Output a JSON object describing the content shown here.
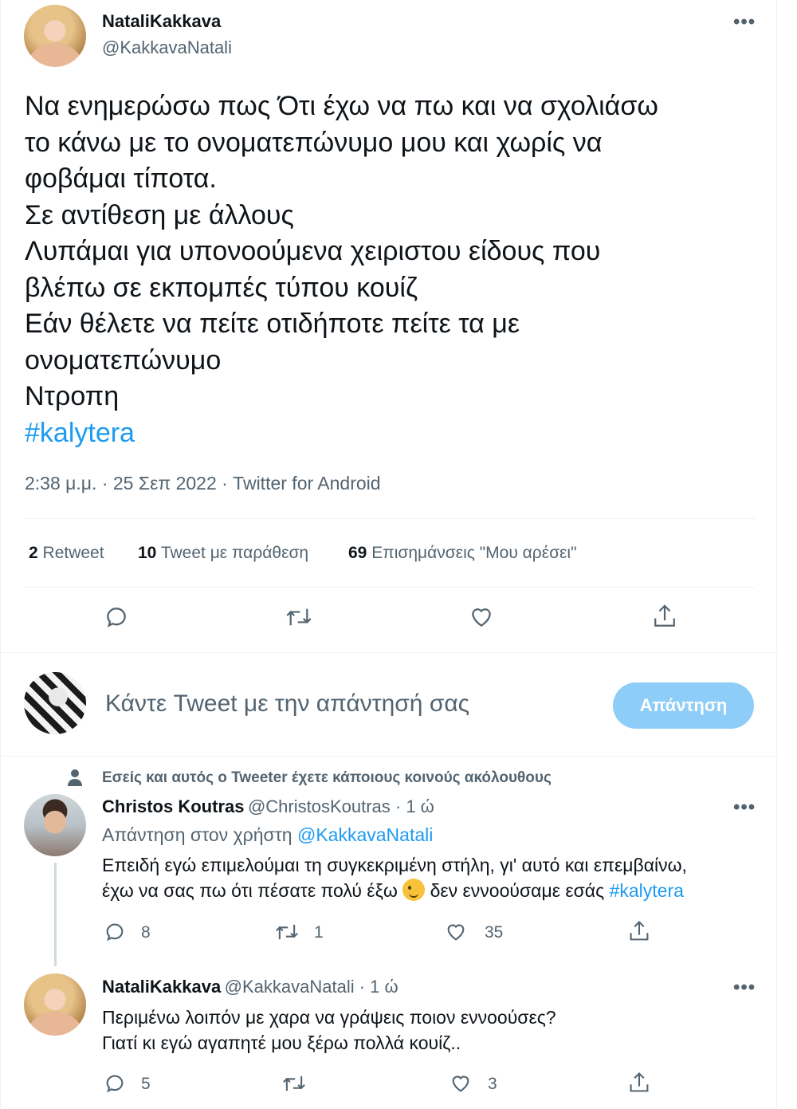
{
  "main_tweet": {
    "author_name": "NataliKakkava",
    "author_handle": "@KakkavaNatali",
    "more_label": "•••",
    "lines": [
      "Να ενημερώσω πως Ότι έχω να πω και να σχολιάσω",
      "το κάνω με το ονοματεπώνυμο μου και χωρίς να",
      "φοβάμαι τίποτα.",
      "Σε αντίθεση με άλλους",
      "Λυπάμαι για υπονοούμενα χειριστου είδους που",
      "βλέπω σε εκπομπές τύπου κουίζ",
      "Εάν θέλετε να πείτε οτιδήποτε πείτε τα με",
      "ονοματεπώνυμο",
      "Ντροπη"
    ],
    "hashtag": "#kalytera",
    "timestamp": "2:38 μ.μ. · 25 Σεπ 2022 · Twitter for Android",
    "stats": {
      "retweets_count": "2",
      "retweets_label": "Retweet",
      "quotes_count": "10",
      "quotes_label": "Tweet με παράθεση",
      "likes_count": "69",
      "likes_label": "Επισημάνσεις \"Μου αρέσει\""
    }
  },
  "compose": {
    "placeholder": "Κάντε Tweet με την απάντησή σας",
    "reply_button": "Απάντηση"
  },
  "replies": [
    {
      "context": "Εσείς και αυτός ο Tweeter έχετε κάποιους κοινούς ακόλουθους",
      "author_name": "Christos Koutras",
      "author_handle": "@ChristosKoutras · 1 ώ",
      "more_label": "•••",
      "replying_to_label": "Απάντηση στον χρήστη",
      "replying_to_handle": "@KakkavaNatali",
      "line1": "Επειδή εγώ επιμελούμαι τη συγκεκριμένη στήλη, γι' αυτό και επεμβαίνω,",
      "line2_before": "έχω να σας πω ότι πέσατε πολύ έξω",
      "line2_after": "δεν εννοούσαμε εσάς",
      "hashtag": "#kalytera",
      "reply_count": "8",
      "retweet_count": "1",
      "like_count": "35"
    },
    {
      "author_name": "NataliKakkava",
      "author_handle": "@KakkavaNatali · 1 ώ",
      "more_label": "•••",
      "line1": "Περιμένω λοιπόν με χαρα να γράψεις ποιον εννοούσες?",
      "line2": "Γιατί κι εγώ αγαπητέ μου ξέρω πολλά κουίζ..",
      "reply_count": "5",
      "retweet_count": "",
      "like_count": "3"
    }
  ],
  "icons": {
    "reply": "reply-icon",
    "retweet": "retweet-icon",
    "like": "heart-icon",
    "share": "share-icon",
    "person": "person-icon",
    "emoji": "winking-face-emoji"
  },
  "colors": {
    "accent": "#1d9bf0",
    "reply_button_disabled": "#8ecdf8",
    "text_primary": "#0f1419",
    "text_secondary": "#536471",
    "divider": "#eff3f4"
  }
}
